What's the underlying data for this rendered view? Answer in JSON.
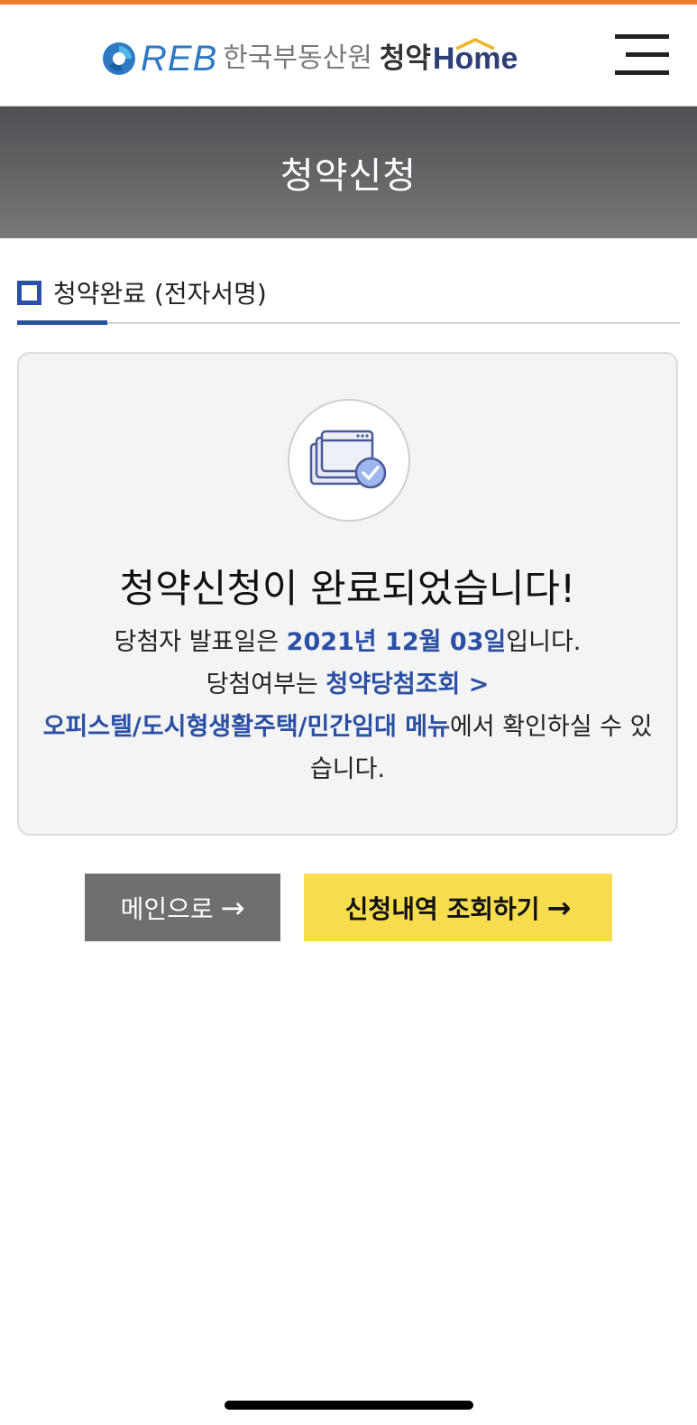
{
  "header": {
    "logo_reb": "REB",
    "logo_org": "한국부동산원",
    "logo_cheongyak": "청약",
    "logo_home": "Home",
    "menu_icon": "hamburger-menu-icon",
    "accent_color": "#f07a2c"
  },
  "banner": {
    "title": "청약신청"
  },
  "section": {
    "title": "청약완료 (전자서명)",
    "accent_color": "#2a4fa6"
  },
  "result": {
    "icon": "document-check-icon",
    "title": "청약신청이 완료되었습니다!",
    "line1_prefix": "당첨자 발표일은 ",
    "announce_date": "2021년 12월 03일",
    "line1_suffix": "입니다.",
    "line2_prefix": "당첨여부는 ",
    "menu_path_part1": "청약당첨조회 >",
    "menu_path_part2": "오피스텔/도시형생활주택/민간임대 메뉴",
    "line3_suffix": "에서 확인하실 수 있습니다."
  },
  "buttons": {
    "main_label": "메인으로",
    "history_label": "신청내역 조회하기",
    "arrow_glyph": "→",
    "main_bg": "#6f6f6f",
    "history_bg": "#f7dc4d"
  }
}
